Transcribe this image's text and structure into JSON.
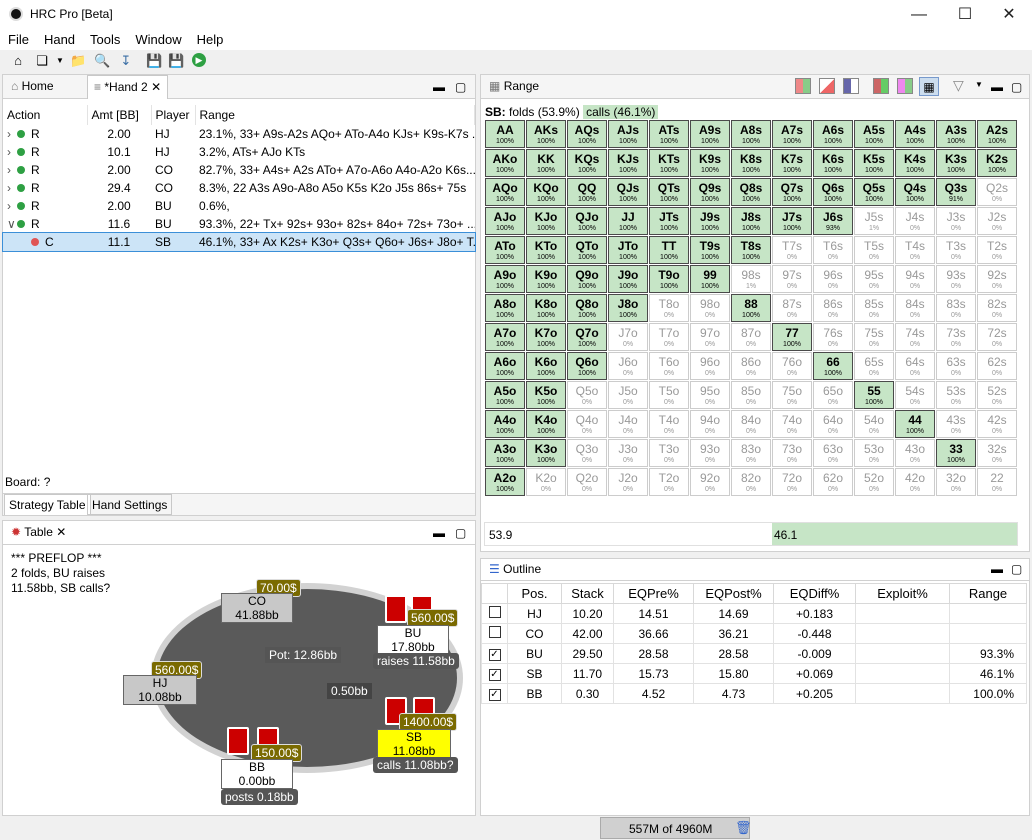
{
  "window": {
    "title": "HRC Pro [Beta]"
  },
  "menu": [
    "File",
    "Hand",
    "Tools",
    "Window",
    "Help"
  ],
  "left_tabs": {
    "home": "Home",
    "hand": "*Hand 2"
  },
  "action_table": {
    "headers": [
      "Action",
      "Amt [BB]",
      "Player",
      "Range"
    ],
    "rows": [
      {
        "action": "R",
        "amt": "2.00",
        "player": "HJ",
        "range": "23.1%, 33+ A9s-A2s AQo+ ATo-A4o KJs+ K9s-K7s ..."
      },
      {
        "action": "R",
        "amt": "10.1",
        "player": "HJ",
        "range": "3.2%, ATs+ AJo KTs"
      },
      {
        "action": "R",
        "amt": "2.00",
        "player": "CO",
        "range": "82.7%, 33+ A4s+ A2s ATo+ A7o-A6o A4o-A2o K6s..."
      },
      {
        "action": "R",
        "amt": "29.4",
        "player": "CO",
        "range": "8.3%, 22 A3s A9o-A8o A5o K5s K2o J5s 86s+ 75s"
      },
      {
        "action": "R",
        "amt": "2.00",
        "player": "BU",
        "range": "0.6%,"
      },
      {
        "action": "R",
        "amt": "11.6",
        "player": "BU",
        "range": "93.3%, 22+ Tx+ 92s+ 93o+ 82s+ 84o+ 72s+ 73o+ ..."
      },
      {
        "action": "C",
        "amt": "11.1",
        "player": "SB",
        "range": "46.1%, 33+ Ax K2s+ K3o+ Q3s+ Q6o+ J6s+ J8o+ T..."
      }
    ]
  },
  "board": "Board: ?",
  "bottom_tabs": [
    "Strategy Table",
    "Hand Settings"
  ],
  "range_panel": {
    "title": "Range",
    "sb_label": "SB:",
    "folds": "folds (53.9%)",
    "calls": "calls (46.1%)",
    "bar_left": "53.9",
    "bar_right": "46.1",
    "bar_fraction_calls": 0.461
  },
  "range_grid": [
    [
      [
        "AA",
        "100%",
        1
      ],
      [
        "AKs",
        "100%",
        1
      ],
      [
        "AQs",
        "100%",
        1
      ],
      [
        "AJs",
        "100%",
        1
      ],
      [
        "ATs",
        "100%",
        1
      ],
      [
        "A9s",
        "100%",
        1
      ],
      [
        "A8s",
        "100%",
        1
      ],
      [
        "A7s",
        "100%",
        1
      ],
      [
        "A6s",
        "100%",
        1
      ],
      [
        "A5s",
        "100%",
        1
      ],
      [
        "A4s",
        "100%",
        1
      ],
      [
        "A3s",
        "100%",
        1
      ],
      [
        "A2s",
        "100%",
        1
      ]
    ],
    [
      [
        "AKo",
        "100%",
        1
      ],
      [
        "KK",
        "100%",
        1
      ],
      [
        "KQs",
        "100%",
        1
      ],
      [
        "KJs",
        "100%",
        1
      ],
      [
        "KTs",
        "100%",
        1
      ],
      [
        "K9s",
        "100%",
        1
      ],
      [
        "K8s",
        "100%",
        1
      ],
      [
        "K7s",
        "100%",
        1
      ],
      [
        "K6s",
        "100%",
        1
      ],
      [
        "K5s",
        "100%",
        1
      ],
      [
        "K4s",
        "100%",
        1
      ],
      [
        "K3s",
        "100%",
        1
      ],
      [
        "K2s",
        "100%",
        1
      ]
    ],
    [
      [
        "AQo",
        "100%",
        1
      ],
      [
        "KQo",
        "100%",
        1
      ],
      [
        "QQ",
        "100%",
        1
      ],
      [
        "QJs",
        "100%",
        1
      ],
      [
        "QTs",
        "100%",
        1
      ],
      [
        "Q9s",
        "100%",
        1
      ],
      [
        "Q8s",
        "100%",
        1
      ],
      [
        "Q7s",
        "100%",
        1
      ],
      [
        "Q6s",
        "100%",
        1
      ],
      [
        "Q5s",
        "100%",
        1
      ],
      [
        "Q4s",
        "100%",
        1
      ],
      [
        "Q3s",
        "91%",
        1
      ],
      [
        "Q2s",
        "0%",
        0
      ]
    ],
    [
      [
        "AJo",
        "100%",
        1
      ],
      [
        "KJo",
        "100%",
        1
      ],
      [
        "QJo",
        "100%",
        1
      ],
      [
        "JJ",
        "100%",
        1
      ],
      [
        "JTs",
        "100%",
        1
      ],
      [
        "J9s",
        "100%",
        1
      ],
      [
        "J8s",
        "100%",
        1
      ],
      [
        "J7s",
        "100%",
        1
      ],
      [
        "J6s",
        "93%",
        1
      ],
      [
        "J5s",
        "1%",
        0
      ],
      [
        "J4s",
        "0%",
        0
      ],
      [
        "J3s",
        "0%",
        0
      ],
      [
        "J2s",
        "0%",
        0
      ]
    ],
    [
      [
        "ATo",
        "100%",
        1
      ],
      [
        "KTo",
        "100%",
        1
      ],
      [
        "QTo",
        "100%",
        1
      ],
      [
        "JTo",
        "100%",
        1
      ],
      [
        "TT",
        "100%",
        1
      ],
      [
        "T9s",
        "100%",
        1
      ],
      [
        "T8s",
        "100%",
        1
      ],
      [
        "T7s",
        "0%",
        0
      ],
      [
        "T6s",
        "0%",
        0
      ],
      [
        "T5s",
        "0%",
        0
      ],
      [
        "T4s",
        "0%",
        0
      ],
      [
        "T3s",
        "0%",
        0
      ],
      [
        "T2s",
        "0%",
        0
      ]
    ],
    [
      [
        "A9o",
        "100%",
        1
      ],
      [
        "K9o",
        "100%",
        1
      ],
      [
        "Q9o",
        "100%",
        1
      ],
      [
        "J9o",
        "100%",
        1
      ],
      [
        "T9o",
        "100%",
        1
      ],
      [
        "99",
        "100%",
        1
      ],
      [
        "98s",
        "1%",
        0
      ],
      [
        "97s",
        "0%",
        0
      ],
      [
        "96s",
        "0%",
        0
      ],
      [
        "95s",
        "0%",
        0
      ],
      [
        "94s",
        "0%",
        0
      ],
      [
        "93s",
        "0%",
        0
      ],
      [
        "92s",
        "0%",
        0
      ]
    ],
    [
      [
        "A8o",
        "100%",
        1
      ],
      [
        "K8o",
        "100%",
        1
      ],
      [
        "Q8o",
        "100%",
        1
      ],
      [
        "J8o",
        "100%",
        1
      ],
      [
        "T8o",
        "0%",
        0
      ],
      [
        "98o",
        "0%",
        0
      ],
      [
        "88",
        "100%",
        1
      ],
      [
        "87s",
        "0%",
        0
      ],
      [
        "86s",
        "0%",
        0
      ],
      [
        "85s",
        "0%",
        0
      ],
      [
        "84s",
        "0%",
        0
      ],
      [
        "83s",
        "0%",
        0
      ],
      [
        "82s",
        "0%",
        0
      ]
    ],
    [
      [
        "A7o",
        "100%",
        1
      ],
      [
        "K7o",
        "100%",
        1
      ],
      [
        "Q7o",
        "100%",
        1
      ],
      [
        "J7o",
        "0%",
        0
      ],
      [
        "T7o",
        "0%",
        0
      ],
      [
        "97o",
        "0%",
        0
      ],
      [
        "87o",
        "0%",
        0
      ],
      [
        "77",
        "100%",
        1
      ],
      [
        "76s",
        "0%",
        0
      ],
      [
        "75s",
        "0%",
        0
      ],
      [
        "74s",
        "0%",
        0
      ],
      [
        "73s",
        "0%",
        0
      ],
      [
        "72s",
        "0%",
        0
      ]
    ],
    [
      [
        "A6o",
        "100%",
        1
      ],
      [
        "K6o",
        "100%",
        1
      ],
      [
        "Q6o",
        "100%",
        1
      ],
      [
        "J6o",
        "0%",
        0
      ],
      [
        "T6o",
        "0%",
        0
      ],
      [
        "96o",
        "0%",
        0
      ],
      [
        "86o",
        "0%",
        0
      ],
      [
        "76o",
        "0%",
        0
      ],
      [
        "66",
        "100%",
        1
      ],
      [
        "65s",
        "0%",
        0
      ],
      [
        "64s",
        "0%",
        0
      ],
      [
        "63s",
        "0%",
        0
      ],
      [
        "62s",
        "0%",
        0
      ]
    ],
    [
      [
        "A5o",
        "100%",
        1
      ],
      [
        "K5o",
        "100%",
        1
      ],
      [
        "Q5o",
        "0%",
        0
      ],
      [
        "J5o",
        "0%",
        0
      ],
      [
        "T5o",
        "0%",
        0
      ],
      [
        "95o",
        "0%",
        0
      ],
      [
        "85o",
        "0%",
        0
      ],
      [
        "75o",
        "0%",
        0
      ],
      [
        "65o",
        "0%",
        0
      ],
      [
        "55",
        "100%",
        1
      ],
      [
        "54s",
        "0%",
        0
      ],
      [
        "53s",
        "0%",
        0
      ],
      [
        "52s",
        "0%",
        0
      ]
    ],
    [
      [
        "A4o",
        "100%",
        1
      ],
      [
        "K4o",
        "100%",
        1
      ],
      [
        "Q4o",
        "0%",
        0
      ],
      [
        "J4o",
        "0%",
        0
      ],
      [
        "T4o",
        "0%",
        0
      ],
      [
        "94o",
        "0%",
        0
      ],
      [
        "84o",
        "0%",
        0
      ],
      [
        "74o",
        "0%",
        0
      ],
      [
        "64o",
        "0%",
        0
      ],
      [
        "54o",
        "0%",
        0
      ],
      [
        "44",
        "100%",
        1
      ],
      [
        "43s",
        "0%",
        0
      ],
      [
        "42s",
        "0%",
        0
      ]
    ],
    [
      [
        "A3o",
        "100%",
        1
      ],
      [
        "K3o",
        "100%",
        1
      ],
      [
        "Q3o",
        "0%",
        0
      ],
      [
        "J3o",
        "0%",
        0
      ],
      [
        "T3o",
        "0%",
        0
      ],
      [
        "93o",
        "0%",
        0
      ],
      [
        "83o",
        "0%",
        0
      ],
      [
        "73o",
        "0%",
        0
      ],
      [
        "63o",
        "0%",
        0
      ],
      [
        "53o",
        "0%",
        0
      ],
      [
        "43o",
        "0%",
        0
      ],
      [
        "33",
        "100%",
        1
      ],
      [
        "32s",
        "0%",
        0
      ]
    ],
    [
      [
        "A2o",
        "100%",
        1
      ],
      [
        "K2o",
        "0%",
        0
      ],
      [
        "Q2o",
        "0%",
        0
      ],
      [
        "J2o",
        "0%",
        0
      ],
      [
        "T2o",
        "0%",
        0
      ],
      [
        "92o",
        "0%",
        0
      ],
      [
        "82o",
        "0%",
        0
      ],
      [
        "72o",
        "0%",
        0
      ],
      [
        "62o",
        "0%",
        0
      ],
      [
        "52o",
        "0%",
        0
      ],
      [
        "42o",
        "0%",
        0
      ],
      [
        "32o",
        "0%",
        0
      ],
      [
        "22",
        "0%",
        0
      ]
    ]
  ],
  "table_panel": {
    "title": "Table",
    "log": [
      "*** PREFLOP ***",
      "2 folds, BU raises",
      "11.58bb, SB calls?"
    ],
    "pot": "Pot:  12.86bb",
    "center_bet": "0.50bb",
    "seats": {
      "co": {
        "name": "CO",
        "stack": "41.88bb",
        "chips": "70.00$"
      },
      "hj": {
        "name": "HJ",
        "stack": "10.08bb",
        "chips": "560.00$"
      },
      "bu": {
        "name": "BU",
        "stack": "17.80bb",
        "chips": "560.00$",
        "action": "raises 11.58bb"
      },
      "sb": {
        "name": "SB",
        "stack": "11.08bb",
        "chips": "1400.00$",
        "action": "calls 11.08bb?"
      },
      "bb": {
        "name": "BB",
        "stack": "0.00bb",
        "chips": "150.00$",
        "action": "posts 0.18bb"
      }
    }
  },
  "outline_panel": {
    "title": "Outline",
    "headers": [
      "Pos.",
      "Stack",
      "EQPre%",
      "EQPost%",
      "EQDiff%",
      "Exploit%",
      "Range"
    ],
    "rows": [
      {
        "checked": false,
        "pos": "HJ",
        "stack": "10.20",
        "eqpre": "14.51",
        "eqpost": "14.69",
        "eqdiff": "+0.183",
        "exploit": "",
        "range": ""
      },
      {
        "checked": false,
        "pos": "CO",
        "stack": "42.00",
        "eqpre": "36.66",
        "eqpost": "36.21",
        "eqdiff": "-0.448",
        "exploit": "",
        "range": ""
      },
      {
        "checked": true,
        "pos": "BU",
        "stack": "29.50",
        "eqpre": "28.58",
        "eqpost": "28.58",
        "eqdiff": "-0.009",
        "exploit": "",
        "range": "93.3%"
      },
      {
        "checked": true,
        "pos": "SB",
        "stack": "11.70",
        "eqpre": "15.73",
        "eqpost": "15.80",
        "eqdiff": "+0.069",
        "exploit": "",
        "range": "46.1%"
      },
      {
        "checked": true,
        "pos": "BB",
        "stack": "0.30",
        "eqpre": "4.52",
        "eqpost": "4.73",
        "eqdiff": "+0.205",
        "exploit": "",
        "range": "100.0%"
      }
    ]
  },
  "status": {
    "memory": "557M of 4960M"
  },
  "colors": {
    "range_on": "#c6e5c6",
    "sb_seat": "#ffff00",
    "chip": "#7a6a00",
    "felt": "#5a5a5a",
    "felt_rim": "#d0d0d0"
  }
}
